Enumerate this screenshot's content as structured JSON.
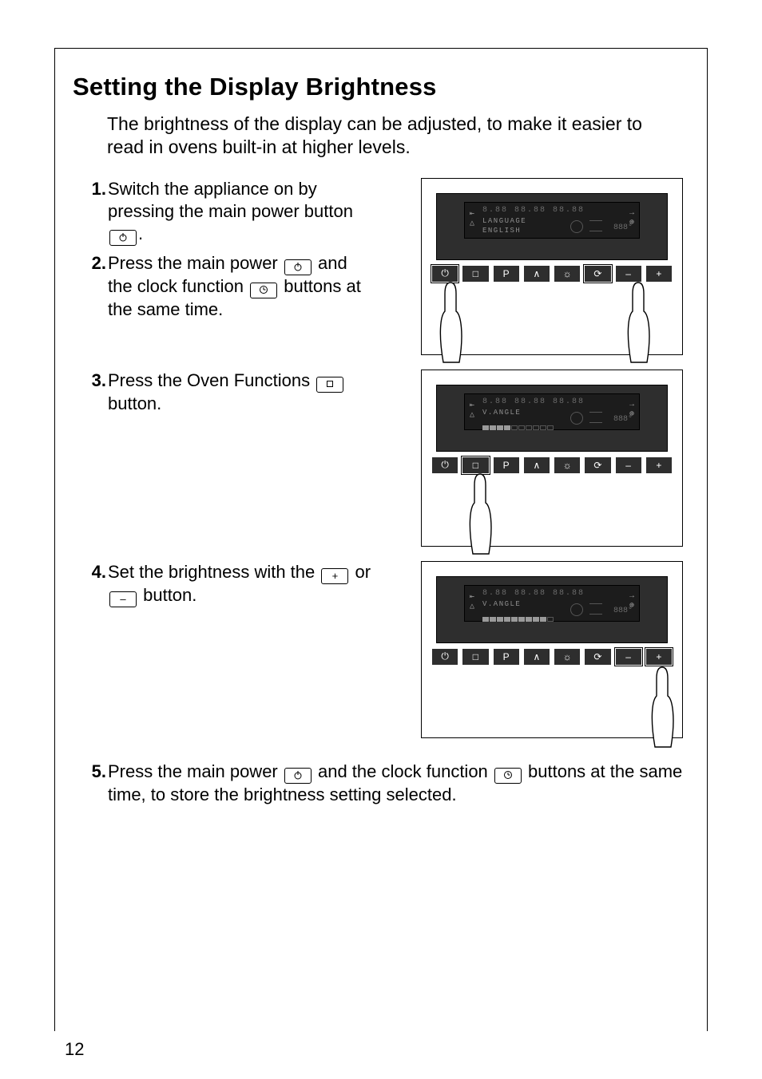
{
  "page_number": "12",
  "heading": "Setting the Display Brightness",
  "intro": "The brightness of the display can be adjusted, to make it easier to read in ovens built-in at higher levels.",
  "steps": {
    "s1": {
      "num": "1.",
      "before": "Switch the appliance on by pressing the main power button ",
      "after": "."
    },
    "s2": {
      "num": "2.",
      "p1": "Press the main power ",
      "p2": " and the clock function ",
      "p3": " buttons at the same time."
    },
    "s3": {
      "num": "3.",
      "p1": "Press the Oven Functions ",
      "p2": " button."
    },
    "s4": {
      "num": "4.",
      "p1": "Set the brightness with the ",
      "p2": " or ",
      "p3": " button."
    },
    "s5": {
      "num": "5.",
      "p1": "Press the main power ",
      "p2": " and the clock function ",
      "p3": " buttons at the same time, to store the brightness setting selected."
    }
  },
  "panel": {
    "digits": "8.88 88.88 88.88",
    "temp": "888°",
    "btn_labels": [
      "⏻",
      "□",
      "P",
      "∧",
      "☼",
      "⟳",
      "–",
      "+"
    ],
    "p1": {
      "line1": "LANGUAGE",
      "line2": "ENGLISH"
    },
    "p2": {
      "line1": "V.ANGLE"
    },
    "p3": {
      "line1": "V.ANGLE"
    }
  },
  "icons": {
    "power": "⏻",
    "clock": "⟳",
    "oven": "□",
    "plus": "+",
    "minus": "–"
  }
}
